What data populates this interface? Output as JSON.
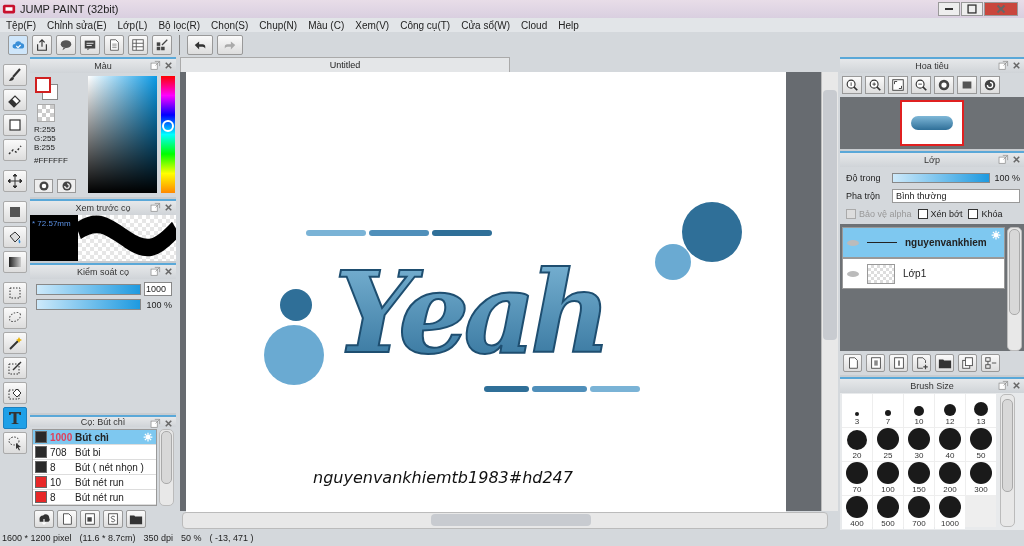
{
  "window": {
    "title": "JUMP PAINT (32bit)"
  },
  "menu": [
    "Tệp(F)",
    "Chỉnh sửa(E)",
    "Lớp(L)",
    "Bộ lọc(R)",
    "Chọn(S)",
    "Chụp(N)",
    "Màu (C)",
    "Xem(V)",
    "Công cụ(T)",
    "Cửa sổ(W)",
    "Cloud",
    "Help"
  ],
  "tools": [
    {
      "selected": false
    },
    {
      "selected": false
    },
    {
      "selected": false
    },
    {
      "selected": false
    },
    {
      "selected": false
    },
    {
      "selected": false
    },
    {
      "selected": false
    },
    {
      "selected": false
    },
    {
      "selected": false
    },
    {
      "selected": false
    },
    {
      "selected": false
    },
    {
      "selected": false
    },
    {
      "selected": false
    },
    {
      "selected": true
    },
    {
      "selected": false
    }
  ],
  "color_panel": {
    "title": "Màu",
    "r": "R:255",
    "g": "G:255",
    "b": "B:255",
    "hex": "#FFFFFF",
    "hue_slider": {
      "level": 0.57
    }
  },
  "brush_preview": {
    "title": "Xem trước cọ",
    "size": "* 72.57mm"
  },
  "brush_control": {
    "title": "Kiểm soát cọ",
    "sliders": [
      {
        "kind": "field",
        "level": 1,
        "reading": "1000"
      },
      {
        "kind": "text",
        "level": 1,
        "reading": "100 %"
      }
    ]
  },
  "brush_list": {
    "title": "Cọ: Bút chì",
    "items": [
      {
        "size": "1000",
        "name": "Bút chì",
        "color": "#2a2a2a",
        "selected": true
      },
      {
        "size": "708",
        "name": "Bút bi",
        "color": "#2a2a2a",
        "selected": false
      },
      {
        "size": "8",
        "name": "Bút ( nét nhọn )",
        "color": "#2a2a2a",
        "selected": false
      },
      {
        "size": "10",
        "name": "Bút nét run",
        "color": "#e82828",
        "selected": false
      },
      {
        "size": "8",
        "name": "Bút nét run",
        "color": "#e82828",
        "selected": false
      }
    ]
  },
  "document": {
    "tab": "Untitled",
    "artwork_text": "Yeah",
    "signature": "nguyenvankhiemtb1983#hd247"
  },
  "navigator": {
    "title": "Hoa tiêu"
  },
  "layers_panel": {
    "title": "Lớp",
    "opacity": {
      "label": "Độ trong",
      "level": 1,
      "reading": "100 %"
    },
    "blend": {
      "label": "Pha trộn",
      "value": "Bình thường"
    },
    "options": [
      {
        "label": "Bảo vệ alpha",
        "checked": false,
        "disabled": true
      },
      {
        "label": "Xén bớt",
        "checked": false,
        "disabled": false
      },
      {
        "label": "Khóa",
        "checked": false,
        "disabled": false
      }
    ],
    "layers": [
      {
        "kind": "text",
        "name": "nguyenvankhiem",
        "selected": true
      },
      {
        "kind": "image",
        "name": "Lớp1",
        "selected": false
      }
    ]
  },
  "brush_size": {
    "title": "Brush Size",
    "sizes": [
      "3",
      "7",
      "10",
      "12",
      "13",
      "20",
      "25",
      "30",
      "40",
      "50",
      "70",
      "100",
      "150",
      "200",
      "300",
      "400",
      "500",
      "700",
      "1000"
    ]
  },
  "status_bar": [
    "1600 * 1200 pixel",
    "(11.6 * 8.7cm)",
    "350 dpi",
    "50 %",
    "( -13, 471 )"
  ]
}
